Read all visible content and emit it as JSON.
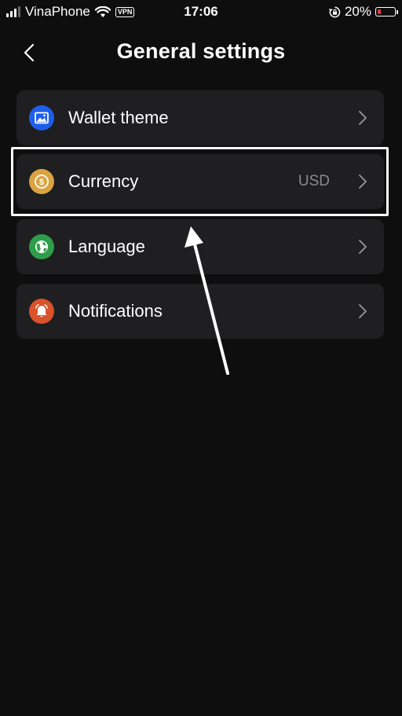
{
  "status_bar": {
    "carrier": "VinaPhone",
    "vpn": "VPN",
    "time": "17:06",
    "battery_percent": "20%",
    "battery_level": 0.2,
    "battery_color": "#e23a3a"
  },
  "header": {
    "title": "General settings",
    "back_icon": "chevron-left-icon"
  },
  "settings": [
    {
      "label": "Wallet theme",
      "icon": "image-icon",
      "icon_bg": "#1f5eea",
      "value": ""
    },
    {
      "label": "Currency",
      "icon": "dollar-coin-icon",
      "icon_bg": "#d9a441",
      "value": "USD"
    },
    {
      "label": "Language",
      "icon": "globe-icon",
      "icon_bg": "#2e9e4a",
      "value": ""
    },
    {
      "label": "Notifications",
      "icon": "bell-icon",
      "icon_bg": "#d9522a",
      "value": ""
    }
  ],
  "annotation": {
    "highlight_color": "#ffffff",
    "highlighted_item": "Currency"
  }
}
